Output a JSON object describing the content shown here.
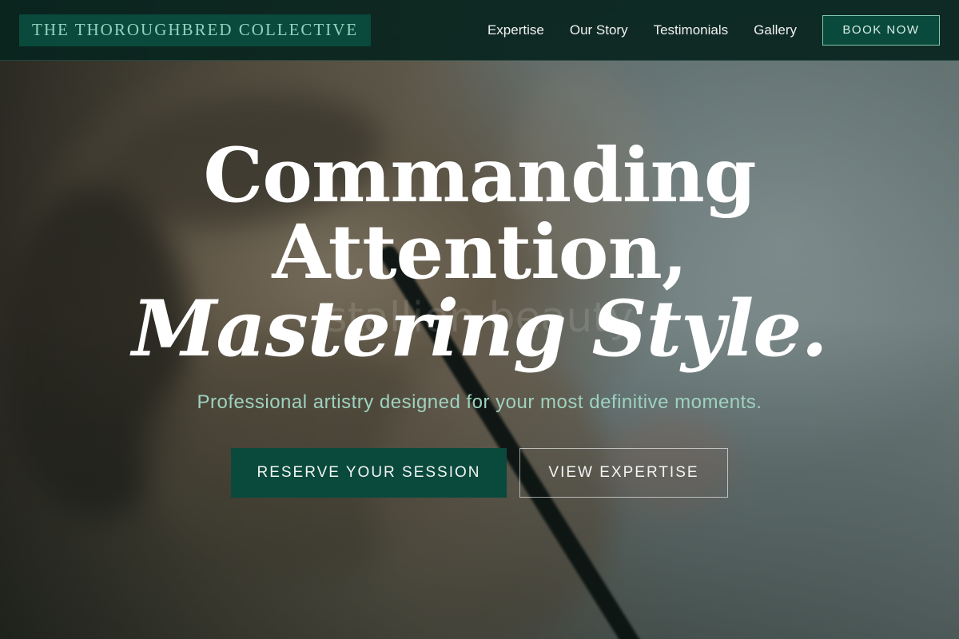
{
  "nav": {
    "brand": "THE THOROUGHBRED COLLECTIVE",
    "links": [
      "Expertise",
      "Our Story",
      "Testimonials",
      "Gallery"
    ],
    "cta": "BOOK NOW"
  },
  "hero": {
    "watermark": "stallion beauty",
    "headline_line1": "Commanding",
    "headline_line2": "Attention,",
    "headline_line3": "Mastering Style.",
    "tagline": "Professional artistry designed for your most definitive moments.",
    "primary_cta": "RESERVE YOUR SESSION",
    "secondary_cta": "VIEW EXPERTISE"
  },
  "colors": {
    "nav_bg": "#08241e",
    "brand_bg": "#0a4a3c",
    "accent_mint": "#8fd4bf",
    "button_primary": "#0a4a3c"
  }
}
